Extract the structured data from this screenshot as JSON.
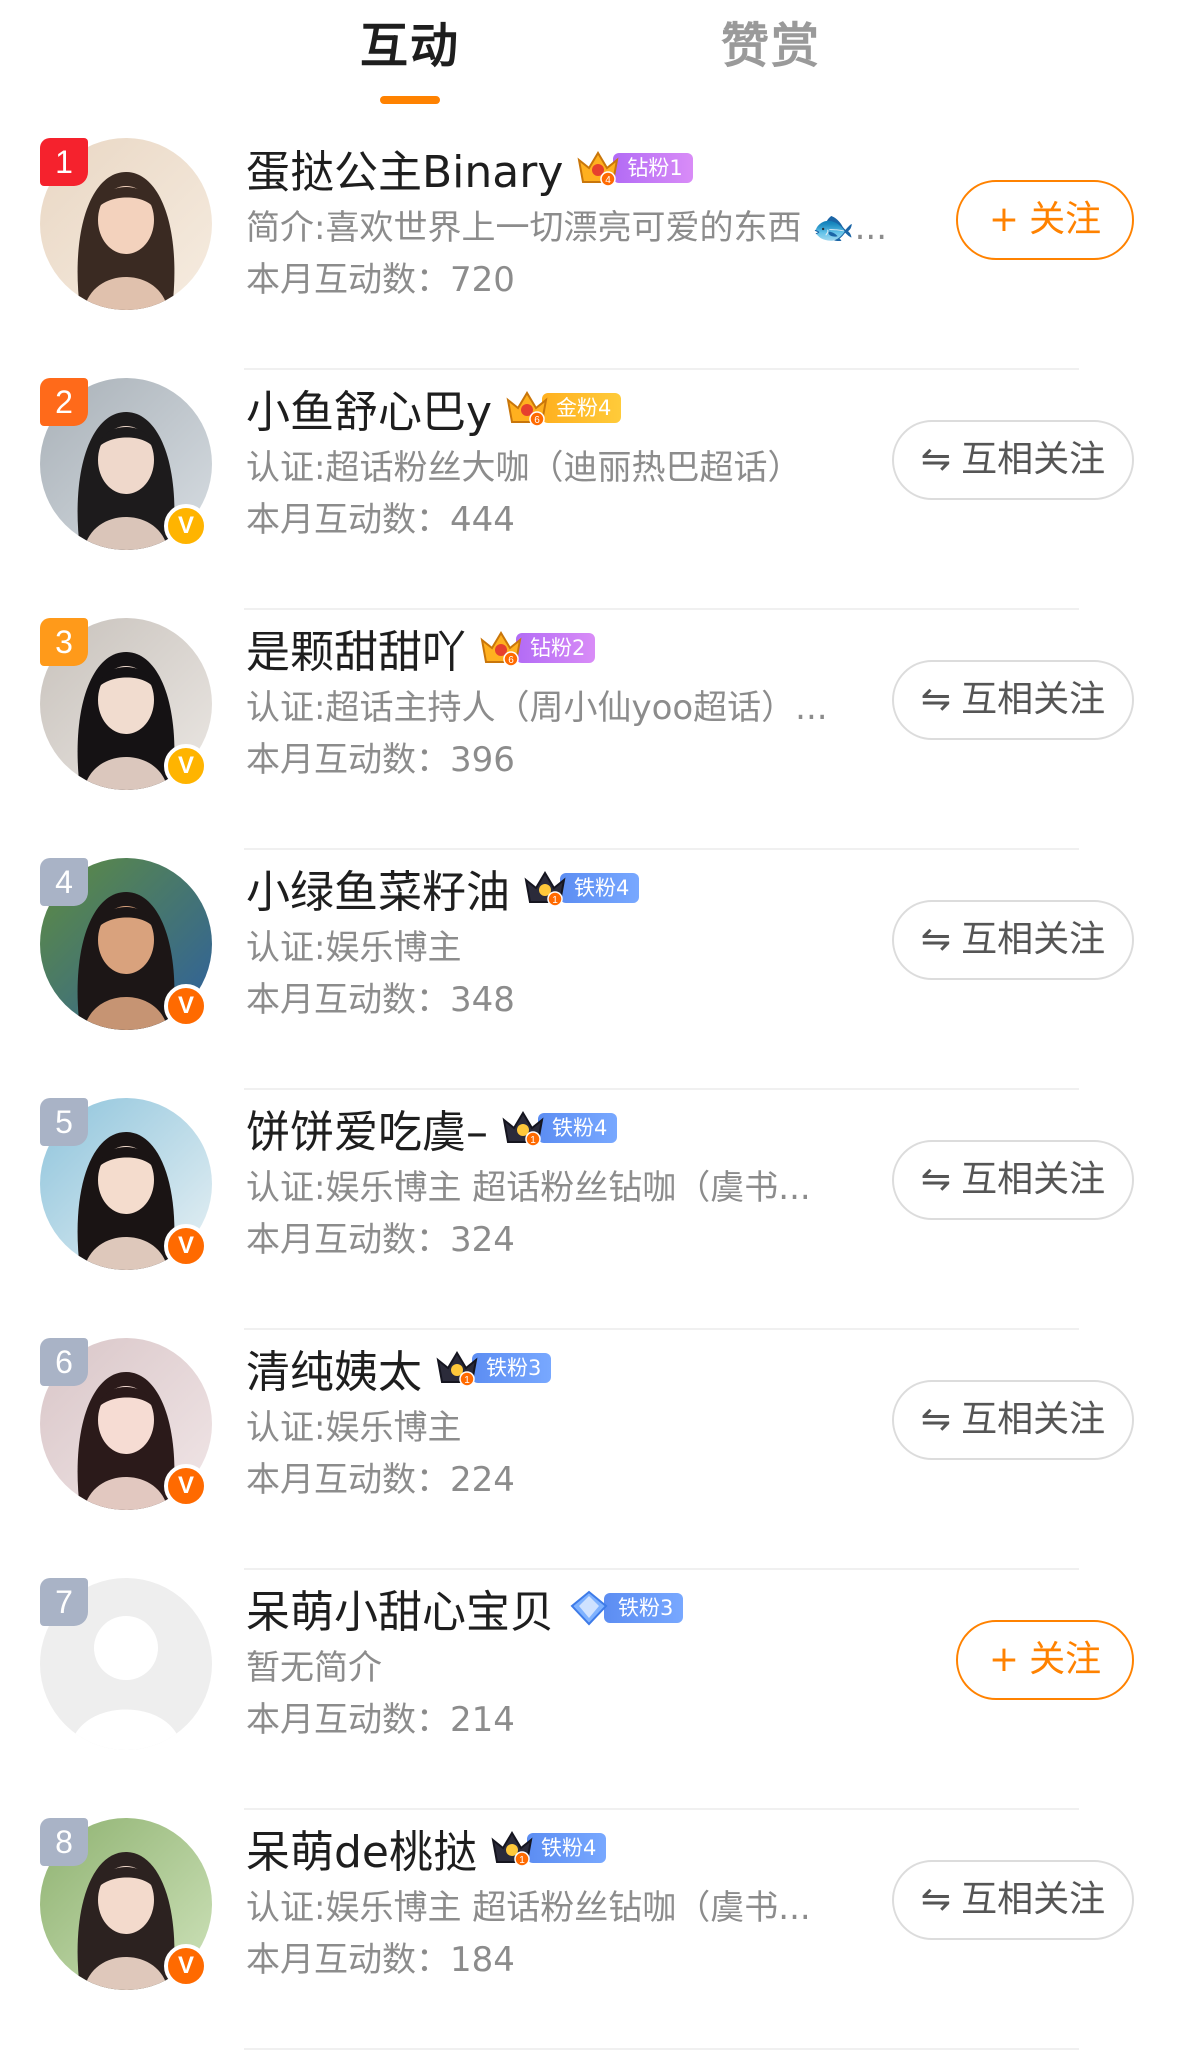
{
  "tabs": [
    {
      "label": "互动",
      "active": true
    },
    {
      "label": "赞赏",
      "active": false
    }
  ],
  "colors": {
    "accent": "#ff8200",
    "rank1": "#f5222d",
    "rank2": "#ff6a1a",
    "rank3": "#ff9a1a",
    "rank_other": "#a9b3c6",
    "badge_diamond": "#b26bf5",
    "badge_gold": "#ffb01f",
    "badge_iron": "#5c8df2"
  },
  "buttons": {
    "follow": {
      "icon": "plus-icon",
      "glyph": "+",
      "label": "关注"
    },
    "mutual": {
      "icon": "swap-arrows-icon",
      "glyph": "⇋",
      "label": "互相关注"
    }
  },
  "users": [
    {
      "rank": "1",
      "name": "蛋挞公主Binary",
      "badge": {
        "type": "diamond",
        "label": "钻粉1",
        "level": "4"
      },
      "desc": "简介:喜欢世界上一切漂亮可爱的东西 🐟...",
      "count": "本月互动数：720",
      "verified": "none",
      "button": "follow"
    },
    {
      "rank": "2",
      "name": "小鱼舒心巴y",
      "badge": {
        "type": "gold",
        "label": "金粉4",
        "level": "6"
      },
      "desc": "认证:超话粉丝大咖（迪丽热巴超话）",
      "count": "本月互动数：444",
      "verified": "yellow",
      "button": "mutual"
    },
    {
      "rank": "3",
      "name": "是颗甜甜吖",
      "badge": {
        "type": "diamond",
        "label": "钻粉2",
        "level": "6"
      },
      "desc": "认证:超话主持人（周小仙yoo超话）...",
      "count": "本月互动数：396",
      "verified": "yellow",
      "button": "mutual"
    },
    {
      "rank": "4",
      "name": "小绿鱼菜籽油",
      "badge": {
        "type": "iron",
        "label": "铁粉4",
        "level": "1"
      },
      "desc": "认证:娱乐博主",
      "count": "本月互动数：348",
      "verified": "orange",
      "button": "mutual"
    },
    {
      "rank": "5",
      "name": "饼饼爱吃虞–",
      "badge": {
        "type": "iron",
        "label": "铁粉4",
        "level": "1"
      },
      "desc": "认证:娱乐博主 超话粉丝钻咖（虞书...",
      "count": "本月互动数：324",
      "verified": "orange",
      "button": "mutual"
    },
    {
      "rank": "6",
      "name": "清纯姨太",
      "badge": {
        "type": "iron",
        "label": "铁粉3",
        "level": "1"
      },
      "desc": "认证:娱乐博主",
      "count": "本月互动数：224",
      "verified": "orange",
      "button": "mutual"
    },
    {
      "rank": "7",
      "name": "呆萌小甜心宝贝",
      "badge": {
        "type": "iron-diamond",
        "label": "铁粉3",
        "level": ""
      },
      "desc": "暂无简介",
      "count": "本月互动数：214",
      "verified": "none",
      "button": "follow"
    },
    {
      "rank": "8",
      "name": "呆萌de桃挞",
      "badge": {
        "type": "iron",
        "label": "铁粉4",
        "level": "1"
      },
      "desc": "认证:娱乐博主 超话粉丝钻咖（虞书...",
      "count": "本月互动数：184",
      "verified": "orange",
      "button": "mutual"
    }
  ],
  "verify_glyph": "V"
}
